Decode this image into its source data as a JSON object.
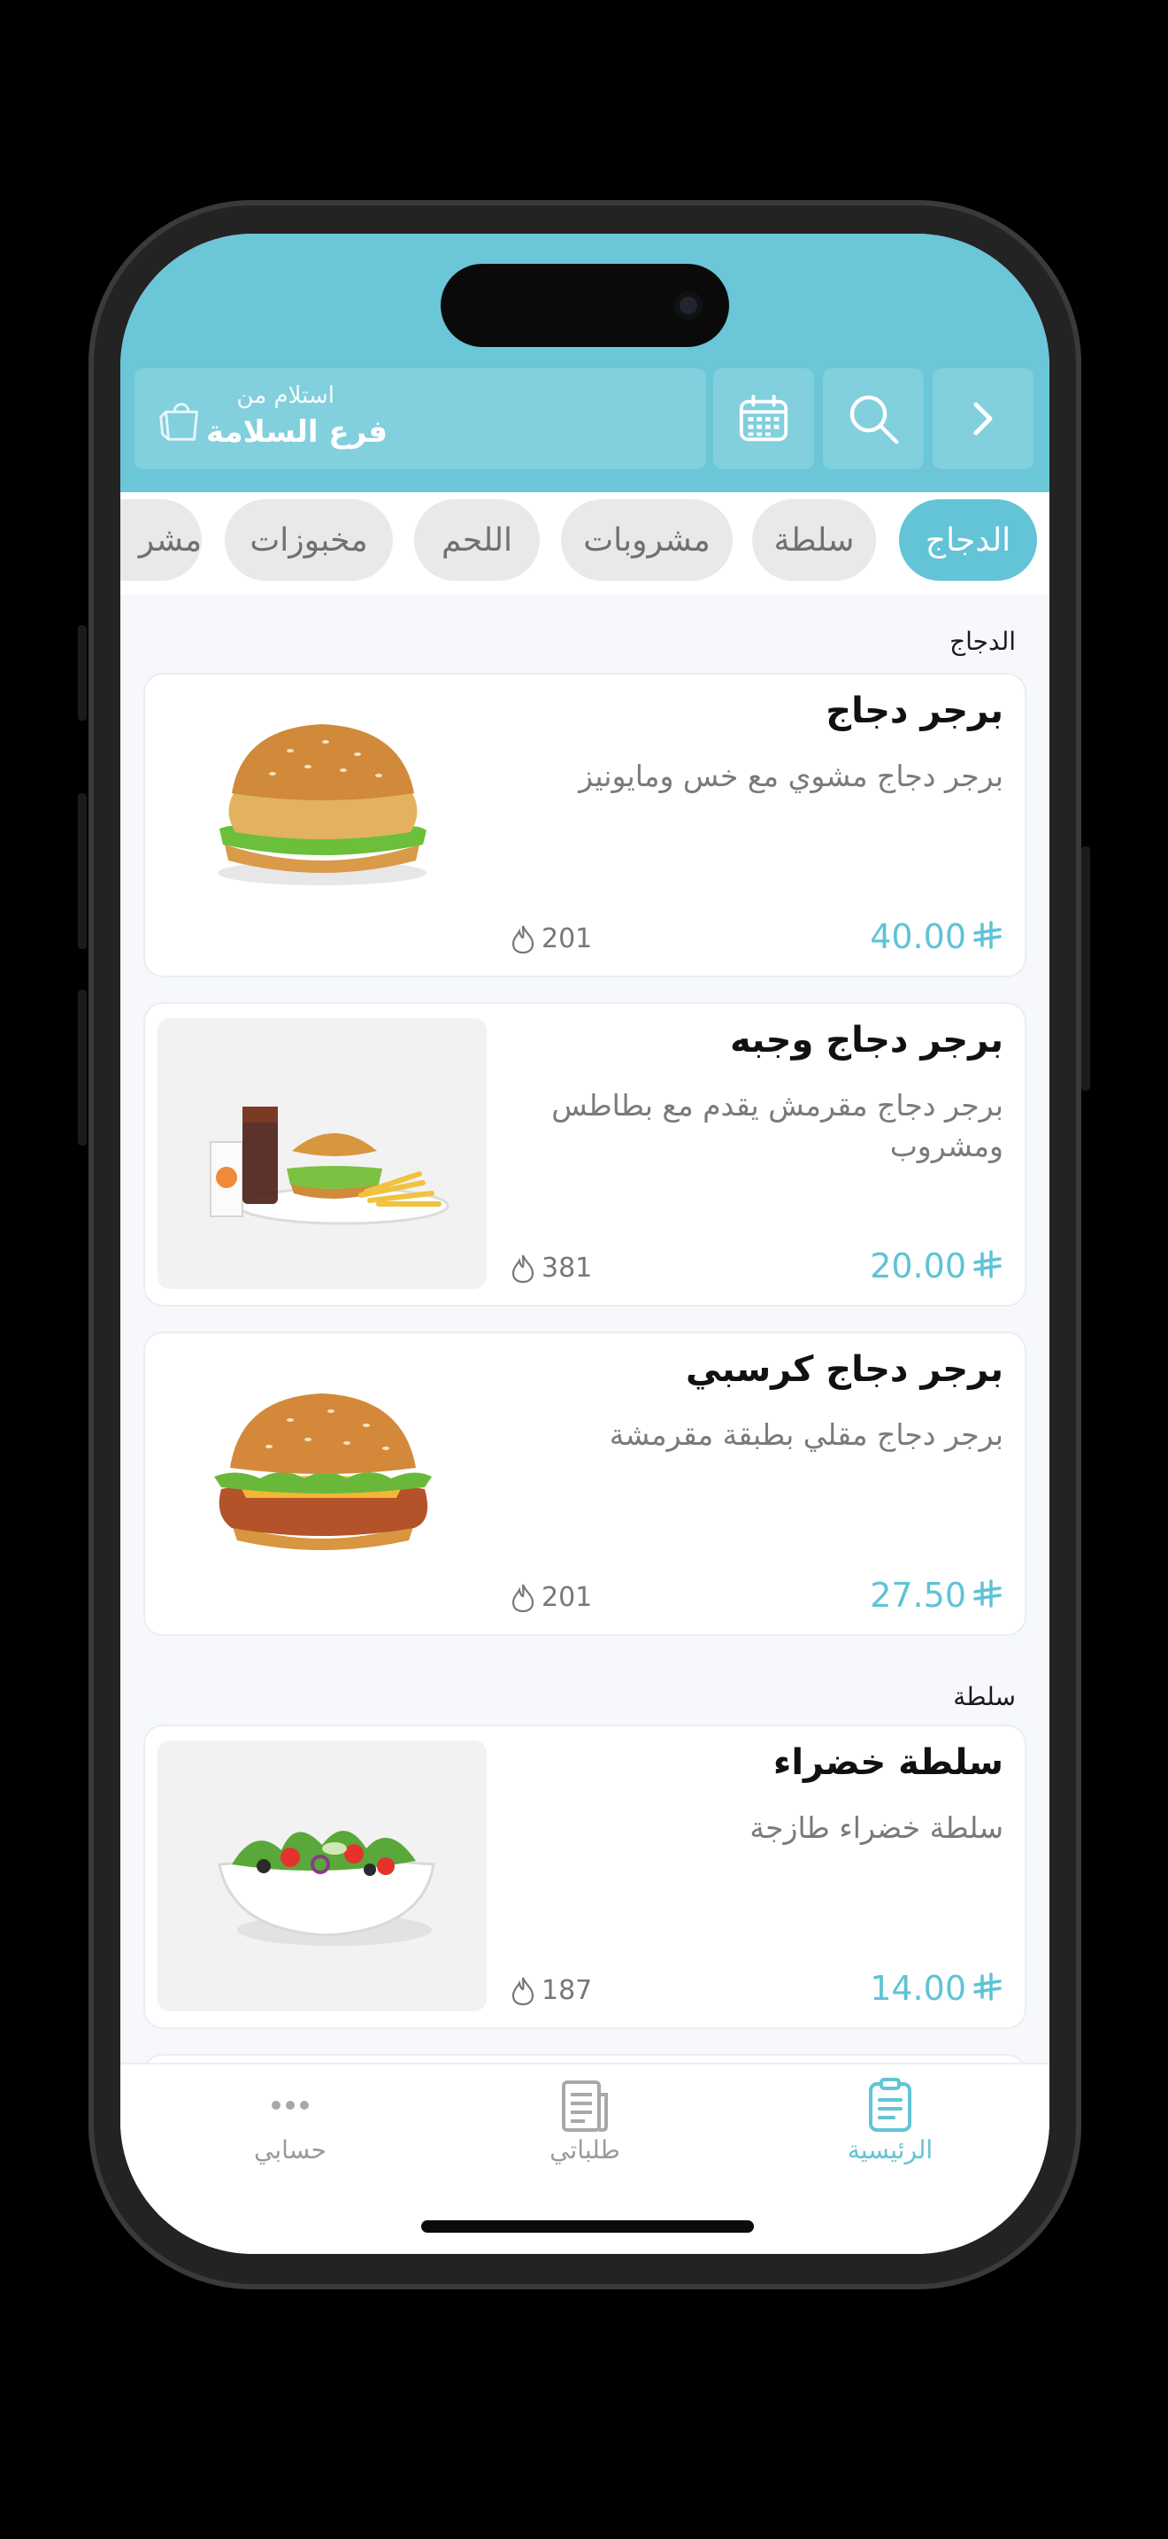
{
  "header": {
    "pickup_label": "استلام من",
    "branch_name": "فرع السلامة"
  },
  "tabs": [
    "الدجاج",
    "سلطة",
    "مشروبات",
    "اللحم",
    "مخبوزات",
    "مشر"
  ],
  "active_tab": "الدجاج",
  "sections": [
    {
      "title": "الدجاج",
      "items": [
        {
          "name": "برجر دجاج",
          "description": "برجر دجاج مشوي مع خس ومايونيز",
          "price": "40.00",
          "calories": "201"
        },
        {
          "name": "برجر دجاج وجبه",
          "description": "برجر دجاج مقرمش يقدم مع بطاطس ومشروب",
          "price": "20.00",
          "calories": "381"
        },
        {
          "name": "برجر دجاج كرسبي",
          "description": "برجر دجاج مقلي بطبقة مقرمشة",
          "price": "27.50",
          "calories": "201"
        }
      ]
    },
    {
      "title": "سلطة",
      "items": [
        {
          "name": "سلطة خضراء",
          "description": "سلطة خضراء طازجة",
          "price": "14.00",
          "calories": "187"
        }
      ]
    }
  ],
  "bottom_nav": [
    {
      "label": "الرئيسية",
      "icon": "menu-clipboard-icon",
      "active": true
    },
    {
      "label": "طلباتي",
      "icon": "orders-receipt-icon",
      "active": false
    },
    {
      "label": "حسابي",
      "icon": "more-dots-icon",
      "active": false
    }
  ],
  "colors": {
    "accent": "#62c4d6",
    "header": "#6bc6d7",
    "muted": "#7a7a7a"
  }
}
